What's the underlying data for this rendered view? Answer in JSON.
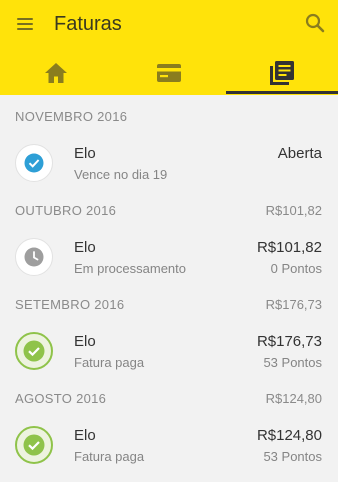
{
  "header": {
    "title": "Faturas",
    "menu_icon": "menu-icon",
    "search_icon": "search-icon",
    "background_color": "#ffe30a"
  },
  "tabs": [
    {
      "icon": "home-icon",
      "selected": false
    },
    {
      "icon": "credit-card-icon",
      "selected": false
    },
    {
      "icon": "invoices-icon",
      "selected": true
    }
  ],
  "sections": [
    {
      "month": "NOVEMBRO 2016",
      "total": "",
      "item": {
        "name": "Elo",
        "subtitle": "Vence no dia 19",
        "amount": "Aberta",
        "points": "",
        "status_icon": "check-circle-icon",
        "status": "open"
      }
    },
    {
      "month": "OUTUBRO 2016",
      "total": "R$101,82",
      "item": {
        "name": "Elo",
        "subtitle": "Em processamento",
        "amount": "R$101,82",
        "points": "0 Pontos",
        "status_icon": "clock-icon",
        "status": "processing"
      }
    },
    {
      "month": "SETEMBRO 2016",
      "total": "R$176,73",
      "item": {
        "name": "Elo",
        "subtitle": "Fatura paga",
        "amount": "R$176,73",
        "points": "53 Pontos",
        "status_icon": "check-circle-icon",
        "status": "paid"
      }
    },
    {
      "month": "AGOSTO 2016",
      "total": "R$124,80",
      "item": {
        "name": "Elo",
        "subtitle": "Fatura paga",
        "amount": "R$124,80",
        "points": "53 Pontos",
        "status_icon": "check-circle-icon",
        "status": "paid"
      }
    }
  ],
  "colors": {
    "open_check": "#2e9fd6",
    "paid_check": "#8fc34a",
    "processing_clock": "#9e9e9e"
  }
}
